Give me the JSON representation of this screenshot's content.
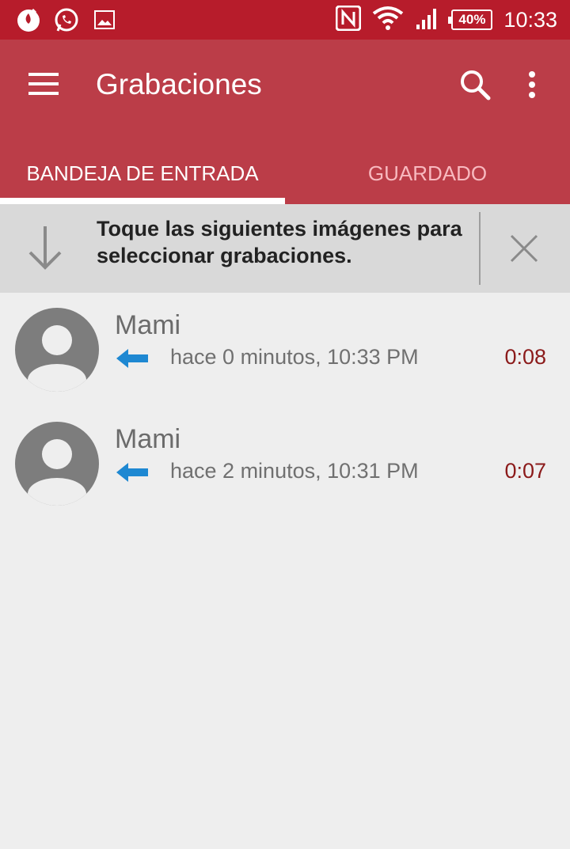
{
  "status_bar": {
    "battery": "40%",
    "time": "10:33",
    "icons": [
      "flame-notification-icon",
      "whatsapp-icon",
      "image-icon",
      "nfc-icon",
      "wifi-icon",
      "signal-icon",
      "battery-icon"
    ]
  },
  "app_bar": {
    "title": "Grabaciones",
    "menu_icon": "hamburger-menu-icon",
    "search_icon": "search-icon",
    "more_icon": "more-vert-icon"
  },
  "tabs": [
    {
      "label": "BANDEJA DE ENTRADA",
      "selected": true
    },
    {
      "label": "GUARDADO",
      "selected": false
    }
  ],
  "hint": {
    "text": "Toque las siguientes imágenes para seleccionar grabaciones.",
    "icon": "arrow-down-icon",
    "close_icon": "close-icon"
  },
  "recordings": [
    {
      "name": "Mami",
      "when": "hace 0 minutos, 10:33 PM",
      "duration": "0:08",
      "direction": "incoming"
    },
    {
      "name": "Mami",
      "when": "hace 2 minutos, 10:31 PM",
      "duration": "0:07",
      "direction": "incoming"
    }
  ],
  "colors": {
    "status_bar": "#b71c2b",
    "app_bar": "#bb3d48",
    "duration": "#8b1a1a",
    "arrow": "#1e88d2",
    "background": "#eeeeee"
  }
}
